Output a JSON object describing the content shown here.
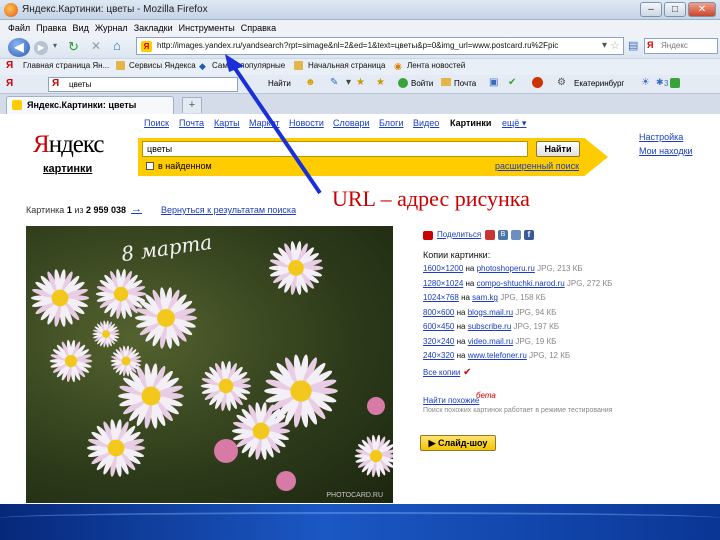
{
  "window": {
    "title": "Яндекс.Картинки: цветы - Mozilla Firefox",
    "min": "–",
    "max": "□",
    "close": "✕"
  },
  "menu": [
    "Файл",
    "Правка",
    "Вид",
    "Журнал",
    "Закладки",
    "Инструменты",
    "Справка"
  ],
  "nav": {
    "url": "http://images.yandex.ru/yandsearch?rpt=simage&nl=2&ed=1&text=цветы&p=0&img_url=www.postcard.ru%2Fpic",
    "search_placeholder": "Яндекс"
  },
  "bookmarks": [
    "Главная страница Ян...",
    "Сервисы Яндекса",
    "Самые популярные",
    "Начальная страница",
    "Лента новостей"
  ],
  "yandex_bar": {
    "search_value": "цветы",
    "find": "Найти",
    "login": "Войти",
    "mail": "Почта",
    "city": "Екатеринбург",
    "weather": "3"
  },
  "tab": {
    "title": "Яндекс.Картинки: цветы"
  },
  "page": {
    "top_links": [
      "Поиск",
      "Почта",
      "Карты",
      "Маркет",
      "Новости",
      "Словари",
      "Блоги",
      "Видео",
      "Картинки",
      "ещё ▾"
    ],
    "logo_red": "Я",
    "logo_rest": "ндекс",
    "logo_sub": "картинки",
    "query": "цветы",
    "find_button": "Найти",
    "in_found": "в найденном",
    "advanced": "расширенный поиск",
    "settings": "Настройка",
    "my_finds": "Мои находки",
    "counter_prefix": "Картинка ",
    "counter_num": "1",
    "counter_of": " из ",
    "counter_total": "2 959 038",
    "next_arrow": "→",
    "back": "Вернуться к результатам поиска",
    "photo_caption": "8 марта",
    "photo_watermark": "PHOTOCARD.RU"
  },
  "side": {
    "share": "Поделиться",
    "copies_title": "Копии картинки:",
    "copies": [
      {
        "size": "1600×1200",
        "on": "на",
        "site": "photoshoperu.ru",
        "meta": "JPG, 213 КБ"
      },
      {
        "size": "1280×1024",
        "on": "на",
        "site": "compo-shtuchki.narod.ru",
        "meta": "JPG, 272 КБ"
      },
      {
        "size": "1024×768",
        "on": "на",
        "site": "sam.kg",
        "meta": "JPG, 158 КБ"
      },
      {
        "size": "800×600",
        "on": "на",
        "site": "blogs.mail.ru",
        "meta": "JPG, 94 КБ"
      },
      {
        "size": "600×450",
        "on": "на",
        "site": "subscribe.ru",
        "meta": "JPG, 197 КБ"
      },
      {
        "size": "320×240",
        "on": "на",
        "site": "video.mail.ru",
        "meta": "JPG, 19 КБ"
      },
      {
        "size": "240×320",
        "on": "на",
        "site": "www.telefoner.ru",
        "meta": "JPG, 12 КБ"
      }
    ],
    "all_copies": "Все копии",
    "find_similar": "Найти похожие",
    "beta": "бета",
    "similar_note": "Поиск похожих картинок работает в режиме тестирования",
    "slideshow": "▶ Слайд-шоу"
  },
  "annotation": "URL – адрес рисунка",
  "colors": {
    "yandex_red": "#cc0000",
    "yandex_yellow": "#ffcc00",
    "link": "#1a3dc1",
    "arrow": "#1a2fd8"
  }
}
